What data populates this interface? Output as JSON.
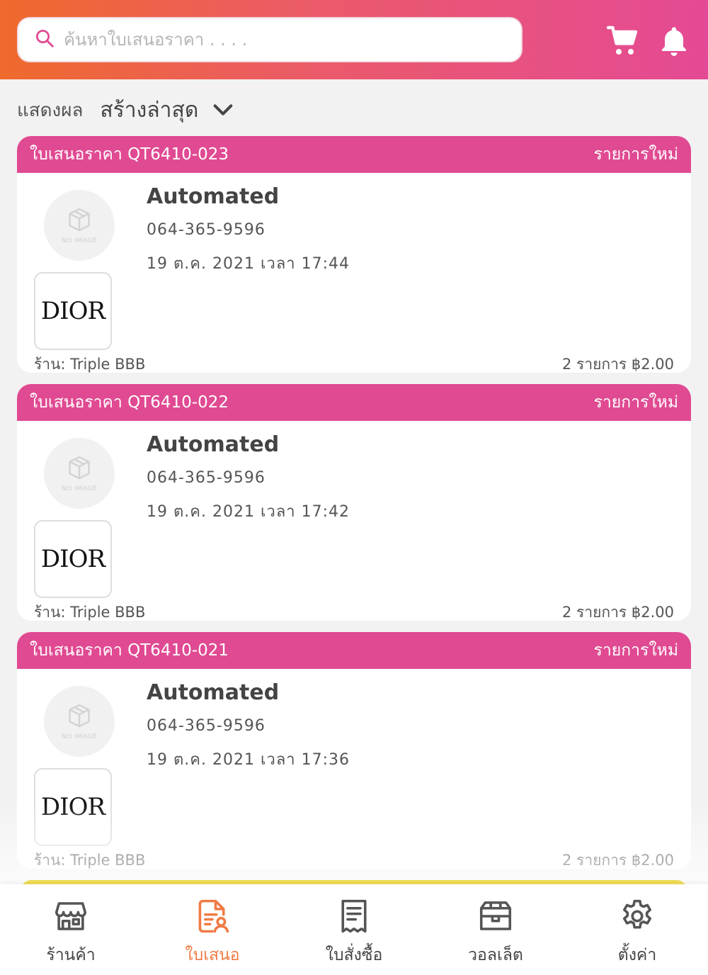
{
  "search": {
    "placeholder": "ค้นหาใบเสนอราคา . . . ."
  },
  "sort": {
    "label": "แสดงผล",
    "value": "สร้างล่าสุด"
  },
  "quotes": [
    {
      "title": "ใบเสนอราคา QT6410-023",
      "status": "รายการใหม่",
      "customer": "Automated",
      "phone": "064-365-9596",
      "date": "19 ต.ค. 2021 เวลา 17:44",
      "no_image": "NO IMAGE",
      "brand": "DIOR",
      "shop": "ร้าน: Triple BBB",
      "total": "2 รายการ ฿2.00"
    },
    {
      "title": "ใบเสนอราคา QT6410-022",
      "status": "รายการใหม่",
      "customer": "Automated",
      "phone": "064-365-9596",
      "date": "19 ต.ค. 2021 เวลา 17:42",
      "no_image": "NO IMAGE",
      "brand": "DIOR",
      "shop": "ร้าน: Triple BBB",
      "total": "2 รายการ ฿2.00"
    },
    {
      "title": "ใบเสนอราคา QT6410-021",
      "status": "รายการใหม่",
      "customer": "Automated",
      "phone": "064-365-9596",
      "date": "19 ต.ค. 2021 เวลา 17:36",
      "no_image": "NO IMAGE",
      "brand": "DIOR",
      "shop": "ร้าน: Triple BBB",
      "total": "2 รายการ ฿2.00"
    }
  ],
  "nav": [
    {
      "label": "ร้านค้า",
      "icon": "store-icon"
    },
    {
      "label": "ใบเสนอ",
      "icon": "quotation-icon",
      "active": true
    },
    {
      "label": "ใบสั่งซื้อ",
      "icon": "receipt-icon"
    },
    {
      "label": "วอลเล็ต",
      "icon": "wallet-icon"
    },
    {
      "label": "ตั้งค่า",
      "icon": "settings-icon"
    }
  ],
  "colors": {
    "header_start": "#ef6a2c",
    "header_end": "#e44a95",
    "card_header": "#e04a92",
    "nav_active": "#f07b46",
    "next_card_status": "#f0dd57"
  }
}
